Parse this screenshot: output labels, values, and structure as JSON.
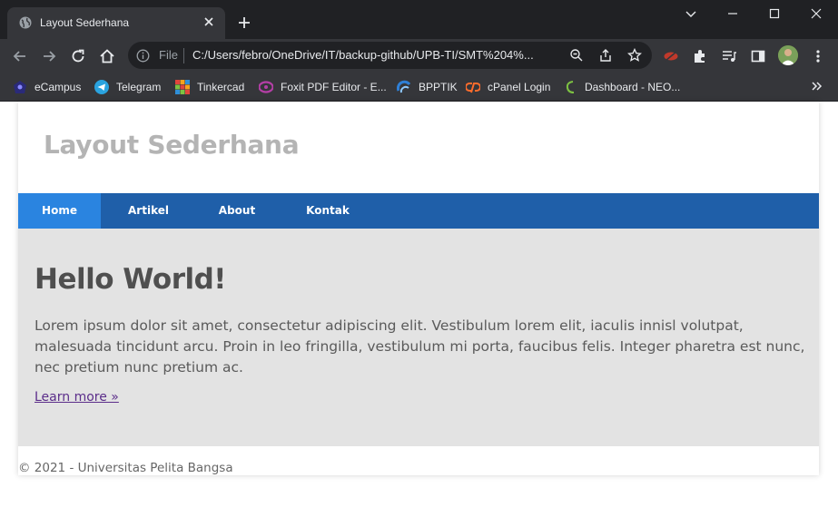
{
  "browser": {
    "tab_title": "Layout Sederhana",
    "scheme_label": "File",
    "url": "C:/Users/febro/OneDrive/IT/backup-github/UPB-TI/SMT%204%...",
    "bookmarks": [
      {
        "label": "eCampus",
        "icon": "ecampus-icon"
      },
      {
        "label": "Telegram",
        "icon": "telegram-icon"
      },
      {
        "label": "Tinkercad",
        "icon": "tinkercad-icon"
      },
      {
        "label": "Foxit PDF Editor - E...",
        "icon": "foxit-icon"
      },
      {
        "label": "BPPTIK",
        "icon": "bpptik-icon"
      },
      {
        "label": "cPanel Login",
        "icon": "cpanel-icon"
      },
      {
        "label": "Dashboard - NEO...",
        "icon": "neo-icon"
      }
    ]
  },
  "site": {
    "title": "Layout Sederhana",
    "nav": [
      {
        "label": "Home",
        "active": true
      },
      {
        "label": "Artikel",
        "active": false
      },
      {
        "label": "About",
        "active": false
      },
      {
        "label": "Kontak",
        "active": false
      }
    ],
    "hero": {
      "heading": "Hello World!",
      "body": "Lorem ipsum dolor sit amet, consectetur adipiscing elit. Vestibulum lorem elit, iaculis innisl volutpat, malesuada tincidunt arcu. Proin in leo fringilla, vestibulum mi porta, faucibus felis. Integer pharetra est nunc, nec pretium nunc pretium ac.",
      "link": "Learn more »"
    },
    "footer": "© 2021 - Universitas Pelita Bangsa"
  },
  "colors": {
    "nav_bg": "#1f5fa9",
    "nav_active": "#2a84e0",
    "hero_bg": "#e3e3e3",
    "title_color": "#b4b4b4",
    "chrome_dark": "#202124",
    "chrome_toolbar": "#35363a"
  }
}
